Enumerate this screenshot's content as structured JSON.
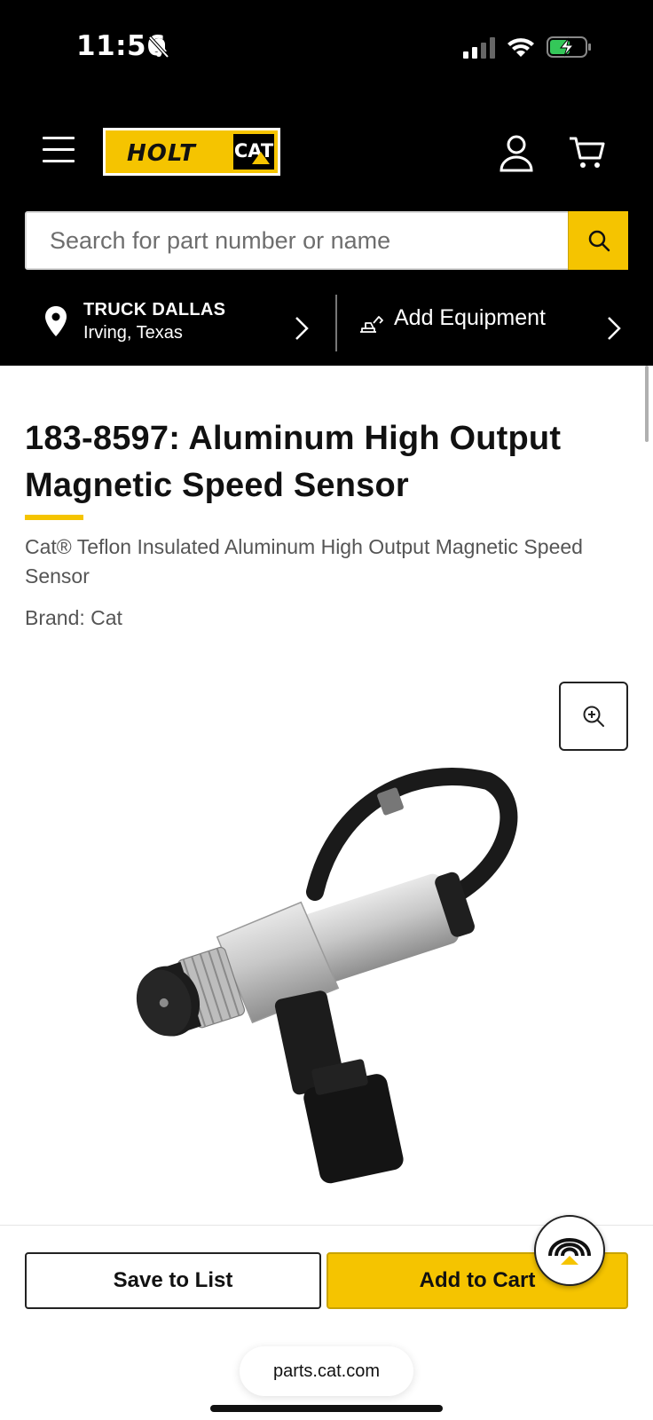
{
  "status_bar": {
    "time": "11:56",
    "icons": [
      "bell-slash-icon",
      "signal-icon",
      "wifi-icon",
      "battery-charging-icon"
    ]
  },
  "header": {
    "logo_text": "HOLT",
    "logo_badge": "CAT",
    "search": {
      "placeholder": "Search for part number or name",
      "value": ""
    },
    "store": {
      "name": "TRUCK DALLAS",
      "location": "Irving, Texas"
    },
    "equipment_label": "Add Equipment"
  },
  "product": {
    "title": "183-8597: Aluminum High Output Magnetic Speed Sensor",
    "subtitle": "Cat® Teflon Insulated Aluminum High Output Magnetic Speed Sensor",
    "brand": "Brand: Cat"
  },
  "actions": {
    "save_label": "Save to List",
    "cart_label": "Add to Cart"
  },
  "browser": {
    "url": "parts.cat.com"
  },
  "colors": {
    "accent": "#f5c400",
    "header_bg": "#000000"
  }
}
